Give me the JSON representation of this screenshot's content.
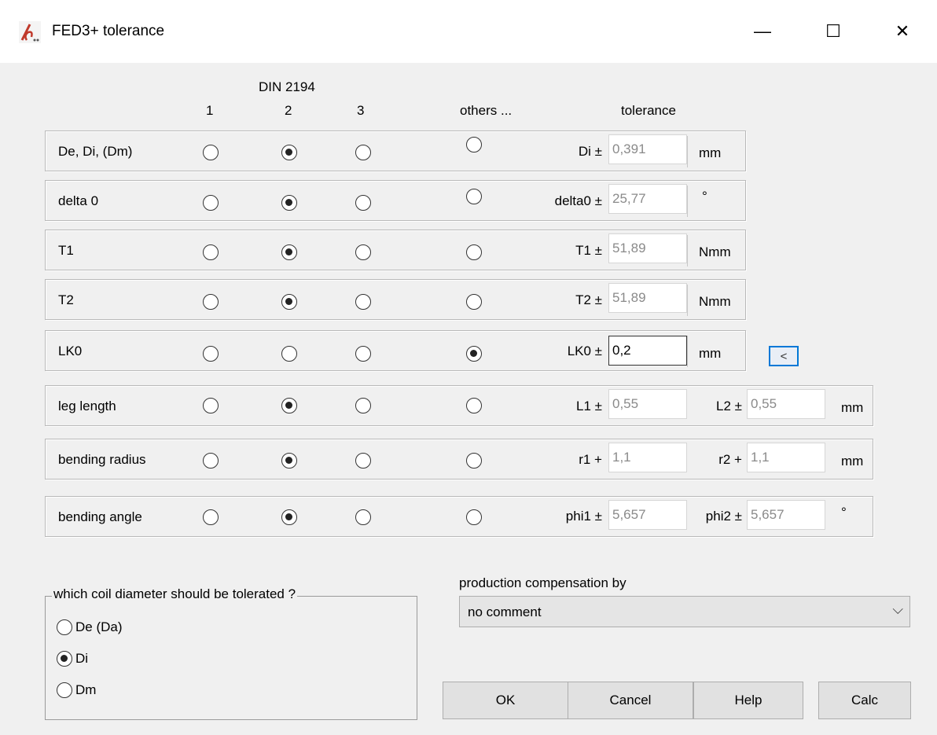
{
  "window": {
    "title": "FED3+ tolerance",
    "minimize_glyph": "—",
    "maximize_glyph": "☐",
    "close_glyph": "✕"
  },
  "header": {
    "standard": "DIN 2194",
    "columns": [
      "1",
      "2",
      "3",
      "others ...",
      "tolerance"
    ]
  },
  "rows": [
    {
      "label": "De, Di, (Dm)",
      "selected": 2,
      "tol1_label": "Di ±",
      "tol1_value": "0,391",
      "unit": "mm"
    },
    {
      "label": "delta 0",
      "selected": 2,
      "tol1_label": "delta0 ±",
      "tol1_value": "25,77",
      "unit": "°"
    },
    {
      "label": "T1",
      "selected": 2,
      "tol1_label": "T1 ±",
      "tol1_value": "51,89",
      "unit": "Nmm"
    },
    {
      "label": "T2",
      "selected": 2,
      "tol1_label": "T2 ±",
      "tol1_value": "51,89",
      "unit": "Nmm"
    },
    {
      "label": "LK0",
      "selected": 4,
      "tol1_label": "LK0 ±",
      "tol1_value": "0,2",
      "unit": "mm",
      "arrow_button": "<"
    },
    {
      "label": "leg length",
      "selected": 2,
      "tol1_label": "L1 ±",
      "tol1_value": "0,55",
      "tol2_label": "L2 ±",
      "tol2_value": "0,55",
      "unit": "mm"
    },
    {
      "label": "bending radius",
      "selected": 2,
      "tol1_label": "r1 +",
      "tol1_value": "1,1",
      "tol2_label": "r2 +",
      "tol2_value": "1,1",
      "unit": "mm"
    },
    {
      "label": "bending angle",
      "selected": 2,
      "tol1_label": "phi1 ±",
      "tol1_value": "5,657",
      "tol2_label": "phi2 ±",
      "tol2_value": "5,657",
      "unit": "°"
    }
  ],
  "coil_group": {
    "legend": "which coil diameter should be tolerated ?",
    "options": [
      "De (Da)",
      "Di",
      "Dm"
    ],
    "selected": 1
  },
  "production": {
    "label": "production compensation by",
    "value": "no comment"
  },
  "buttons": {
    "ok": "OK",
    "cancel": "Cancel",
    "help": "Help",
    "calc": "Calc"
  }
}
